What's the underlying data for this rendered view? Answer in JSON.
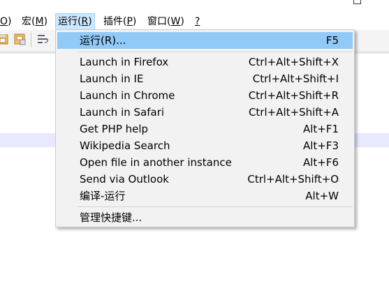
{
  "menubar": {
    "items": [
      {
        "pre": "",
        "key": "O",
        "post": ")"
      },
      {
        "pre": "宏(",
        "key": "M",
        "post": ")"
      },
      {
        "pre": "运行(",
        "key": "R",
        "post": ")"
      },
      {
        "pre": "插件(",
        "key": "P",
        "post": ")"
      },
      {
        "pre": "窗口(",
        "key": "W",
        "post": ")"
      },
      {
        "pre": "",
        "key": "?",
        "post": ""
      }
    ]
  },
  "toolbar": {
    "icons": [
      "save-all-icon",
      "close-file-icon",
      "word-wrap-icon"
    ]
  },
  "run_menu": {
    "items": [
      {
        "label": "运行(R)...",
        "shortcut": "F5"
      },
      {
        "label": "Launch in Firefox",
        "shortcut": "Ctrl+Alt+Shift+X"
      },
      {
        "label": "Launch in IE",
        "shortcut": "Ctrl+Alt+Shift+I"
      },
      {
        "label": "Launch in Chrome",
        "shortcut": "Ctrl+Alt+Shift+R"
      },
      {
        "label": "Launch in Safari",
        "shortcut": "Ctrl+Alt+Shift+A"
      },
      {
        "label": "Get PHP help",
        "shortcut": "Alt+F1"
      },
      {
        "label": "Wikipedia Search",
        "shortcut": "Alt+F3"
      },
      {
        "label": "Open file in another instance",
        "shortcut": "Alt+F6"
      },
      {
        "label": "Send via Outlook",
        "shortcut": "Ctrl+Alt+Shift+O"
      },
      {
        "label": "编译-运行",
        "shortcut": "Alt+W"
      },
      {
        "label": "管理快捷键...",
        "shortcut": ""
      }
    ],
    "highlight_color": "#91c9f7"
  },
  "colors": {
    "menu_active_bg": "#cce8ff",
    "current_line_bg": "#e8e8ff"
  }
}
